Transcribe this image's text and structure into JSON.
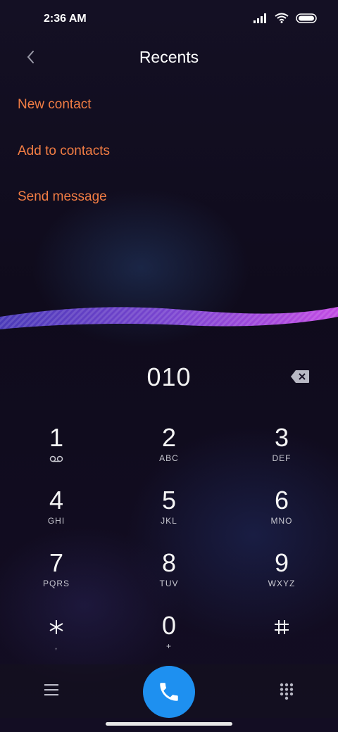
{
  "status": {
    "time": "2:36 AM"
  },
  "header": {
    "title": "Recents"
  },
  "actions": [
    {
      "label": "New contact"
    },
    {
      "label": "Add to contacts"
    },
    {
      "label": "Send message"
    }
  ],
  "dialer": {
    "number": "010",
    "keys": [
      {
        "digit": "1",
        "letters": ""
      },
      {
        "digit": "2",
        "letters": "ABC"
      },
      {
        "digit": "3",
        "letters": "DEF"
      },
      {
        "digit": "4",
        "letters": "GHI"
      },
      {
        "digit": "5",
        "letters": "JKL"
      },
      {
        "digit": "6",
        "letters": "MNO"
      },
      {
        "digit": "7",
        "letters": "PQRS"
      },
      {
        "digit": "8",
        "letters": "TUV"
      },
      {
        "digit": "9",
        "letters": "WXYZ"
      },
      {
        "digit": "",
        "letters": ","
      },
      {
        "digit": "0",
        "letters": "+"
      },
      {
        "digit": "",
        "letters": ""
      }
    ]
  },
  "colors": {
    "accent": "#f27d44",
    "call_button": "#1e90f0",
    "wave_start": "#5a3cc8",
    "wave_end": "#c84be6"
  },
  "icons": {
    "back": "chevron-left-icon",
    "backspace": "backspace-icon",
    "voicemail": "voicemail-icon",
    "star": "asterisk-icon",
    "hash": "hash-icon",
    "menu": "menu-icon",
    "call": "phone-icon",
    "dialpad": "dialpad-icon"
  }
}
